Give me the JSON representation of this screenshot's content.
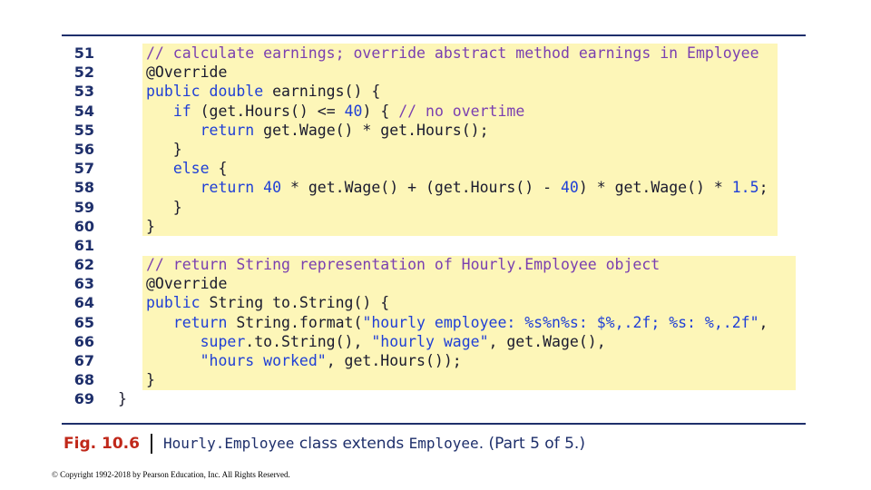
{
  "code": {
    "lines": [
      {
        "num": "51",
        "parts": [
          {
            "text": "// calculate earnings; override abstract method earnings in Employee",
            "cls": "cm"
          }
        ]
      },
      {
        "num": "52",
        "parts": [
          {
            "text": "@Override",
            "cls": ""
          }
        ]
      },
      {
        "num": "53",
        "parts": [
          {
            "text": "public double",
            "cls": "kw"
          },
          {
            "text": " earnings() {",
            "cls": ""
          }
        ]
      },
      {
        "num": "54",
        "parts": [
          {
            "text": "   ",
            "cls": ""
          },
          {
            "text": "if",
            "cls": "kw"
          },
          {
            "text": " (get.Hours() <= ",
            "cls": ""
          },
          {
            "text": "40",
            "cls": "nm"
          },
          {
            "text": ") { ",
            "cls": ""
          },
          {
            "text": "// no overtime",
            "cls": "cm"
          }
        ]
      },
      {
        "num": "55",
        "parts": [
          {
            "text": "      ",
            "cls": ""
          },
          {
            "text": "return",
            "cls": "kw"
          },
          {
            "text": " get.Wage() * get.Hours();",
            "cls": ""
          }
        ]
      },
      {
        "num": "56",
        "parts": [
          {
            "text": "   }",
            "cls": ""
          }
        ]
      },
      {
        "num": "57",
        "parts": [
          {
            "text": "   ",
            "cls": ""
          },
          {
            "text": "else",
            "cls": "kw"
          },
          {
            "text": " {",
            "cls": ""
          }
        ]
      },
      {
        "num": "58",
        "parts": [
          {
            "text": "      ",
            "cls": ""
          },
          {
            "text": "return",
            "cls": "kw"
          },
          {
            "text": " ",
            "cls": ""
          },
          {
            "text": "40",
            "cls": "nm"
          },
          {
            "text": " * get.Wage() + (get.Hours() - ",
            "cls": ""
          },
          {
            "text": "40",
            "cls": "nm"
          },
          {
            "text": ") * get.Wage() * ",
            "cls": ""
          },
          {
            "text": "1.5",
            "cls": "nm"
          },
          {
            "text": ";",
            "cls": ""
          }
        ]
      },
      {
        "num": "59",
        "parts": [
          {
            "text": "   }",
            "cls": ""
          }
        ]
      },
      {
        "num": "60",
        "parts": [
          {
            "text": "}",
            "cls": ""
          }
        ]
      },
      {
        "num": "61",
        "parts": []
      },
      {
        "num": "62",
        "parts": [
          {
            "text": "// return String representation of Hourly.Employee object",
            "cls": "cm"
          }
        ]
      },
      {
        "num": "63",
        "parts": [
          {
            "text": "@Override",
            "cls": ""
          }
        ]
      },
      {
        "num": "64",
        "parts": [
          {
            "text": "public",
            "cls": "kw"
          },
          {
            "text": " String to.String() {",
            "cls": ""
          }
        ]
      },
      {
        "num": "65",
        "parts": [
          {
            "text": "   ",
            "cls": ""
          },
          {
            "text": "return",
            "cls": "kw"
          },
          {
            "text": " String.format(",
            "cls": ""
          },
          {
            "text": "\"hourly employee: %s%n%s: $%,.2f; %s: %,.2f\"",
            "cls": "st"
          },
          {
            "text": ",",
            "cls": ""
          }
        ]
      },
      {
        "num": "66",
        "parts": [
          {
            "text": "      ",
            "cls": ""
          },
          {
            "text": "super",
            "cls": "kw"
          },
          {
            "text": ".to.String(), ",
            "cls": ""
          },
          {
            "text": "\"hourly wage\"",
            "cls": "st"
          },
          {
            "text": ", get.Wage(),",
            "cls": ""
          }
        ]
      },
      {
        "num": "67",
        "parts": [
          {
            "text": "      ",
            "cls": ""
          },
          {
            "text": "\"hours worked\"",
            "cls": "st"
          },
          {
            "text": ", get.Hours());",
            "cls": ""
          }
        ]
      },
      {
        "num": "68",
        "parts": [
          {
            "text": "}",
            "cls": ""
          }
        ]
      },
      {
        "num": "69",
        "indent": "outer",
        "parts": [
          {
            "text": "}",
            "cls": ""
          }
        ]
      }
    ]
  },
  "caption": {
    "fig": "Fig. 10.6",
    "class_name": "Hourly.Employee",
    "middle": " class extends ",
    "parent": "Employee",
    "suffix": ". (Part 5 of 5.)"
  },
  "copyright": "© Copyright 1992-2018 by Pearson Education, Inc. All Rights Reserved."
}
